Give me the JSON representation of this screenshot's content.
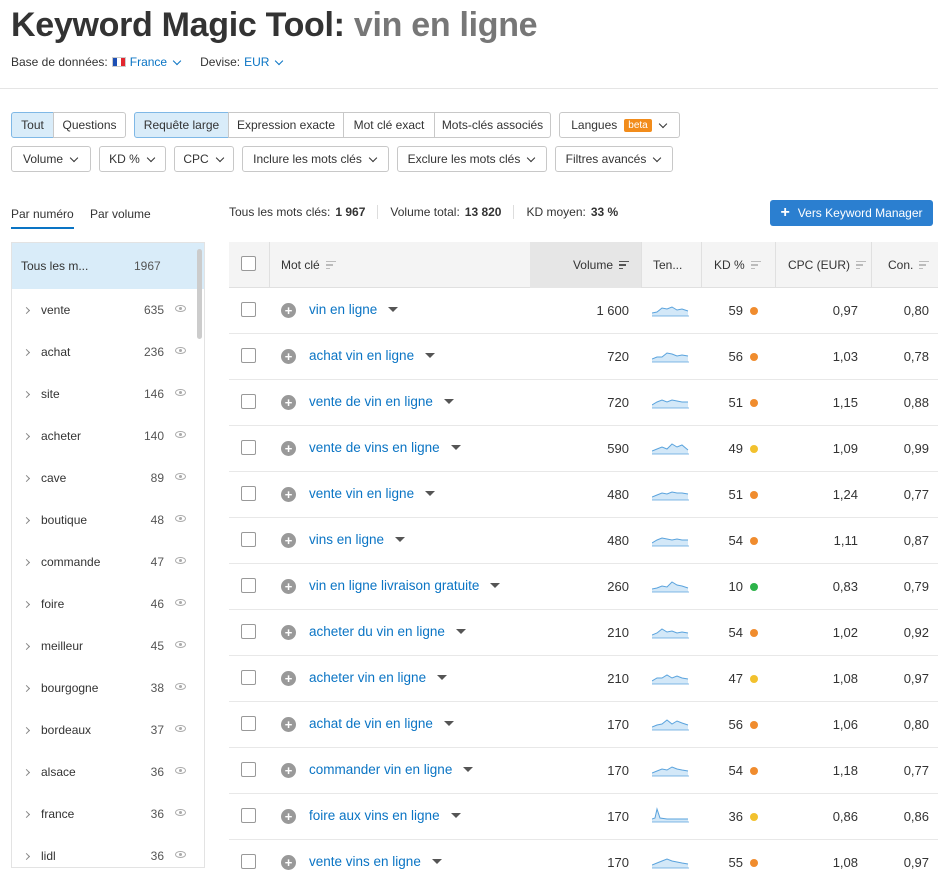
{
  "header": {
    "title_prefix": "Keyword Magic Tool:",
    "query": "vin en ligne",
    "db_label": "Base de données:",
    "db_value": "France",
    "currency_label": "Devise:",
    "currency_value": "EUR"
  },
  "filters": {
    "type_tabs": [
      "Tout",
      "Questions"
    ],
    "match_tabs": [
      "Requête large",
      "Expression exacte",
      "Mot clé exact",
      "Mots-clés associés"
    ],
    "languages": "Langues",
    "languages_badge": "beta",
    "dropdowns": [
      "Volume",
      "KD %",
      "CPC",
      "Inclure les mots clés",
      "Exclure les mots clés",
      "Filtres avancés"
    ]
  },
  "left_tabs": [
    "Par numéro",
    "Par volume"
  ],
  "stats": {
    "all_label": "Tous les mots clés:",
    "all_value": "1 967",
    "volume_label": "Volume total:",
    "volume_value": "13 820",
    "kd_label": "KD moyen:",
    "kd_value": "33 %"
  },
  "km_button": "Vers Keyword Manager",
  "groups": {
    "header_label": "Tous les m...",
    "header_count": "1967",
    "items": [
      {
        "label": "vente",
        "count": "635"
      },
      {
        "label": "achat",
        "count": "236"
      },
      {
        "label": "site",
        "count": "146"
      },
      {
        "label": "acheter",
        "count": "140"
      },
      {
        "label": "cave",
        "count": "89"
      },
      {
        "label": "boutique",
        "count": "48"
      },
      {
        "label": "commande",
        "count": "47"
      },
      {
        "label": "foire",
        "count": "46"
      },
      {
        "label": "meilleur",
        "count": "45"
      },
      {
        "label": "bourgogne",
        "count": "38"
      },
      {
        "label": "bordeaux",
        "count": "37"
      },
      {
        "label": "alsace",
        "count": "36"
      },
      {
        "label": "france",
        "count": "36"
      },
      {
        "label": "lidl",
        "count": "36"
      }
    ]
  },
  "table": {
    "columns": [
      "Mot clé",
      "Volume",
      "Ten...",
      "KD %",
      "CPC (EUR)",
      "Con."
    ],
    "rows": [
      {
        "keyword": "vin en ligne",
        "volume": "1 600",
        "kd": "59",
        "kd_color": "#f08c2e",
        "cpc": "0,97",
        "com": "0,80"
      },
      {
        "keyword": "achat vin en ligne",
        "volume": "720",
        "kd": "56",
        "kd_color": "#f08c2e",
        "cpc": "1,03",
        "com": "0,78"
      },
      {
        "keyword": "vente de vin en ligne",
        "volume": "720",
        "kd": "51",
        "kd_color": "#f08c2e",
        "cpc": "1,15",
        "com": "0,88"
      },
      {
        "keyword": "vente de vins en ligne",
        "volume": "590",
        "kd": "49",
        "kd_color": "#f2c12e",
        "cpc": "1,09",
        "com": "0,99"
      },
      {
        "keyword": "vente vin en ligne",
        "volume": "480",
        "kd": "51",
        "kd_color": "#f08c2e",
        "cpc": "1,24",
        "com": "0,77"
      },
      {
        "keyword": "vins en ligne",
        "volume": "480",
        "kd": "54",
        "kd_color": "#f08c2e",
        "cpc": "1,11",
        "com": "0,87"
      },
      {
        "keyword": "vin en ligne livraison gratuite",
        "volume": "260",
        "kd": "10",
        "kd_color": "#2db34a",
        "cpc": "0,83",
        "com": "0,79"
      },
      {
        "keyword": "acheter du vin en ligne",
        "volume": "210",
        "kd": "54",
        "kd_color": "#f08c2e",
        "cpc": "1,02",
        "com": "0,92"
      },
      {
        "keyword": "acheter vin en ligne",
        "volume": "210",
        "kd": "47",
        "kd_color": "#f2c12e",
        "cpc": "1,08",
        "com": "0,97"
      },
      {
        "keyword": "achat de vin en ligne",
        "volume": "170",
        "kd": "56",
        "kd_color": "#f08c2e",
        "cpc": "1,06",
        "com": "0,80"
      },
      {
        "keyword": "commander vin en ligne",
        "volume": "170",
        "kd": "54",
        "kd_color": "#f08c2e",
        "cpc": "1,18",
        "com": "0,77"
      },
      {
        "keyword": "foire aux vins en ligne",
        "volume": "170",
        "kd": "36",
        "kd_color": "#f2c12e",
        "cpc": "0,86",
        "com": "0,86"
      },
      {
        "keyword": "vente vins en ligne",
        "volume": "170",
        "kd": "55",
        "kd_color": "#f08c2e",
        "cpc": "1,08",
        "com": "0,97"
      }
    ]
  }
}
